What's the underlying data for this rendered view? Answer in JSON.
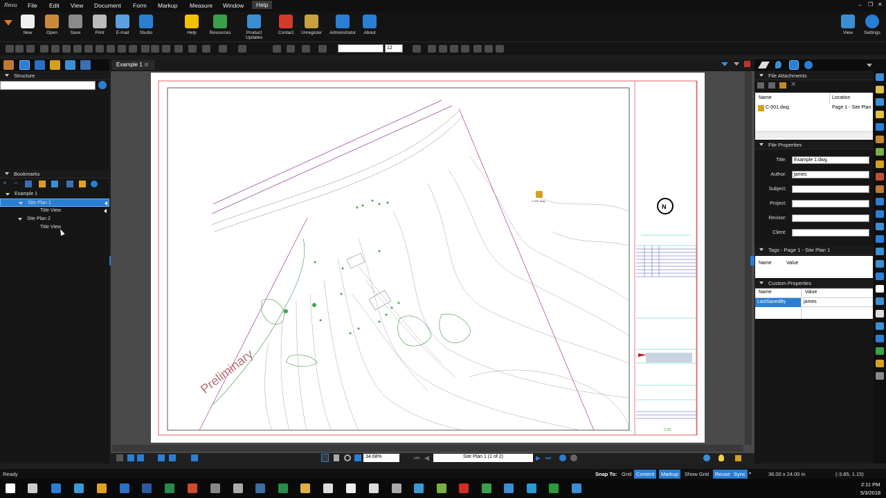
{
  "menu": [
    "File",
    "Edit",
    "View",
    "Document",
    "Form",
    "Markup",
    "Measure",
    "Window",
    "Help"
  ],
  "ribbon": [
    {
      "label": "New",
      "color": "#f0f0f0"
    },
    {
      "label": "Open",
      "color": "#c98a3a"
    },
    {
      "label": "Save",
      "color": "#8a8a8a"
    },
    {
      "label": "Print",
      "color": "#bbbbbb"
    },
    {
      "label": "E-mail",
      "color": "#5aa0e0"
    },
    {
      "label": "Studio",
      "color": "#2a7fd4"
    },
    {
      "label": "Help",
      "color": "#f2c200"
    },
    {
      "label": "Resources",
      "color": "#3aa04a"
    },
    {
      "label": "Product Updates",
      "color": "#3a8fd4"
    },
    {
      "label": "Contact",
      "color": "#d43a2a"
    },
    {
      "label": "Unregister",
      "color": "#c9a040"
    },
    {
      "label": "Administrator",
      "color": "#2a7fd4"
    },
    {
      "label": "About",
      "color": "#2a7fd4"
    }
  ],
  "ribbon_right": [
    {
      "label": "View"
    },
    {
      "label": "Settings"
    }
  ],
  "toolbar": {
    "font_size": "12"
  },
  "left": {
    "structure_title": "Structure",
    "bookmarks_title": "Bookmarks",
    "tree": [
      {
        "label": "Example 1",
        "indent": 0,
        "selected": false
      },
      {
        "label": "Site Plan 1",
        "indent": 1,
        "selected": true
      },
      {
        "label": "Title View",
        "indent": 2,
        "selected": false
      },
      {
        "label": "Site Plan 2",
        "indent": 1,
        "selected": false
      },
      {
        "label": "Title View",
        "indent": 2,
        "selected": false
      }
    ]
  },
  "doc": {
    "tab_label": "Example 1",
    "watermark": "Preliminary",
    "attachment_icon_label": "C-001.dwg",
    "north": "N",
    "zoom": "34.68%",
    "page_label": "Site Plan 1 (1 of 2)"
  },
  "right": {
    "attachments_title": "File Attachments",
    "col_name": "Name",
    "col_location": "Location",
    "attachment_name": "C-001.dwg",
    "attachment_location": "Page 1 - Site Plan",
    "props_title": "File Properties",
    "props": [
      {
        "label": "Title:",
        "value": "Example 1.dwg"
      },
      {
        "label": "Author:",
        "value": "james"
      },
      {
        "label": "Subject:",
        "value": ""
      },
      {
        "label": "Project:",
        "value": ""
      },
      {
        "label": "Revisor:",
        "value": ""
      },
      {
        "label": "Client:",
        "value": ""
      }
    ],
    "tags_title": "Tags - Page 1 - Site Plan 1",
    "tags_name": "Name",
    "tags_value": "Value",
    "custom_title": "Custom Properties",
    "custom_name": "Name",
    "custom_value": "Value",
    "custom_key": "LastSavedBy",
    "custom_val": "james"
  },
  "status": {
    "ready": "Ready",
    "snap_to": "Snap To:",
    "grid": "Grid",
    "content": "Content",
    "markup": "Markup",
    "show_grid": "Show Grid",
    "reuse": "Reuse",
    "sync": "Sync",
    "size": "36.00 x 24.00 in",
    "coords": "(-3.85, 1.15)"
  },
  "clock": {
    "time": "2:11 PM",
    "date": "5/3/2018"
  }
}
